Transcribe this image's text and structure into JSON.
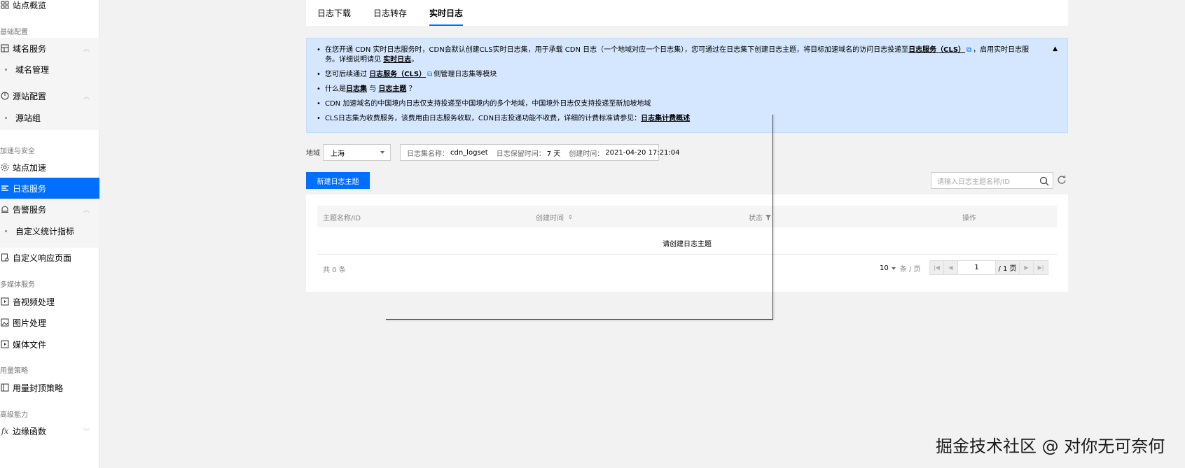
{
  "sidebar": {
    "overview": "站点概览",
    "section_basic": "基础配置",
    "domain_service": "域名服务",
    "domain_manage": "域名管理",
    "origin_config": "源站配置",
    "origin_group": "源站组",
    "section_accel": "加速与安全",
    "site_accel": "站点加速",
    "log_service": "日志服务",
    "alarm_service": "告警服务",
    "custom_metrics": "自定义统计指标",
    "custom_response": "自定义响应页面",
    "section_media": "多媒体服务",
    "av_process": "音视频处理",
    "image_process": "图片处理",
    "media_files": "媒体文件",
    "section_usage": "用量策略",
    "usage_cap": "用量封顶策略",
    "section_advanced": "高级能力",
    "edge_function": "边缘函数"
  },
  "tabs": [
    "日志下载",
    "日志转存",
    "实时日志"
  ],
  "info": {
    "line1_pre": "在您开通 CDN 实时日志服务时，CDN会默认创建CLS实时日志集，用于承载 CDN 日志（一个地域对应一个日志集），您可通过在日志集下创建日志主题，将目标加速域名的访问日志投递至",
    "line1_link": "日志服务（CLS）",
    "line1_post": "，启用实时日志服务。详细说明请见",
    "line1_link2": "实时日志",
    "line1_end": "。",
    "line2_pre": "您可后续通过",
    "line2_link": "日志服务（CLS）",
    "line2_post": "侧管理日志集等模块",
    "line3_pre": "什么是",
    "line3_link1": "日志集",
    "line3_mid": "与",
    "line3_link2": "日志主题",
    "line3_end": "？",
    "line4": "CDN 加速域名的中国境内日志仅支持投递至中国境内的多个地域，中国境外日志仅支持投递至新加坡地域",
    "line5_pre": "CLS日志集为收费服务，该费用由日志服务收取，CDN日志投递功能不收费，详细的计费标准请参见：",
    "line5_link": "日志集计费概述"
  },
  "filter": {
    "region_label": "地域",
    "region_value": "上海",
    "logset_name_label": "日志集名称：",
    "logset_name": "cdn_logset",
    "retention_label": "日志保留时间：",
    "retention": "7 天",
    "created_label": "创建时间：",
    "created": "2021-04-20 17:21:04"
  },
  "toolbar": {
    "create_label": "新建日志主题",
    "search_placeholder": "请输入日志主题名称/ID"
  },
  "table": {
    "columns": [
      "主题名称/ID",
      "创建时间",
      "状态",
      "操作"
    ],
    "empty": "请创建日志主题",
    "total": "共 0 条",
    "page_size": "10",
    "page_size_unit": "条 / 页",
    "page": "1",
    "page_total": "/ 1 页"
  },
  "watermark": "掘金技术社区 @ 对你无可奈何"
}
